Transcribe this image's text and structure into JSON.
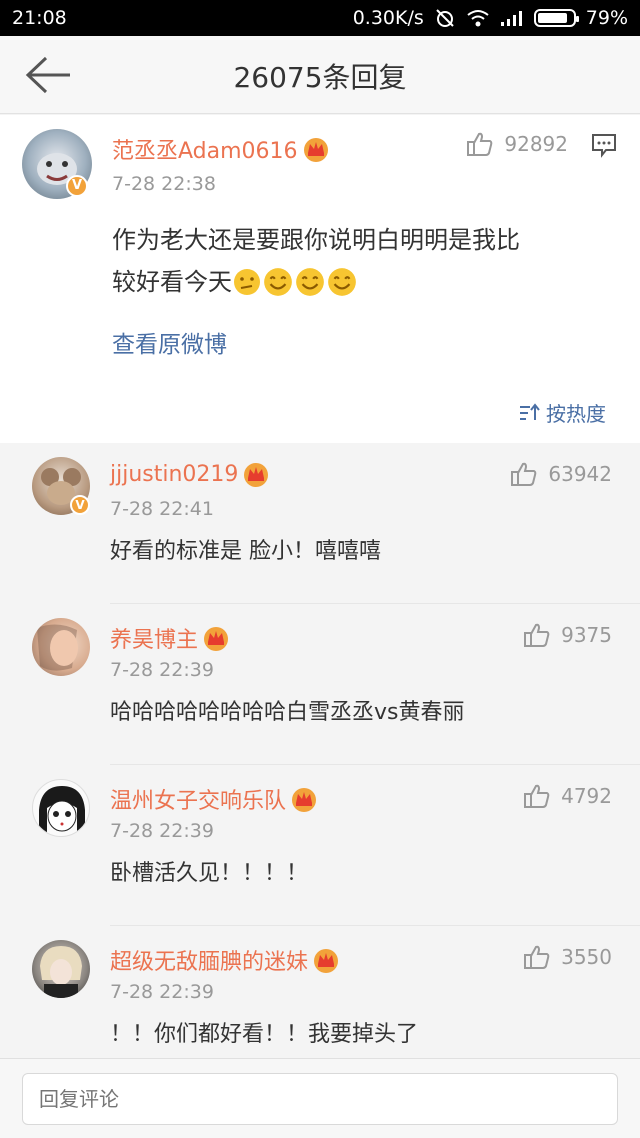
{
  "status_bar": {
    "time": "21:08",
    "network_speed": "0.30K/s",
    "battery": "79%"
  },
  "nav": {
    "title": "26075条回复"
  },
  "main_post": {
    "username": "范丞丞Adam0616",
    "timestamp": "7-28 22:38",
    "likes": "92892",
    "content_line1": "作为老大还是要跟你说明白明明是我比",
    "content_line2": "较好看今天",
    "view_original": "查看原微博",
    "sort_label": "按热度"
  },
  "replies": [
    {
      "username": "jjjustin0219",
      "timestamp": "7-28 22:41",
      "likes": "63942",
      "content": "好看的标准是 脸小！嘻嘻嘻"
    },
    {
      "username": "养昊博主",
      "timestamp": "7-28 22:39",
      "likes": "9375",
      "content": "哈哈哈哈哈哈哈哈白雪丞丞vs黄春丽"
    },
    {
      "username": "温州女子交响乐队",
      "timestamp": "7-28 22:39",
      "likes": "4792",
      "content": "卧槽活久见！！！！"
    },
    {
      "username": "超级无敌腼腆的迷妹",
      "timestamp": "7-28 22:39",
      "likes": "3550",
      "content": "！！你们都好看！！我要掉头了"
    }
  ],
  "bottom": {
    "placeholder": "回复评论"
  },
  "colors": {
    "username": "#eb7350",
    "link": "#4a6fa5",
    "vip_gold": "#f2a23a"
  }
}
